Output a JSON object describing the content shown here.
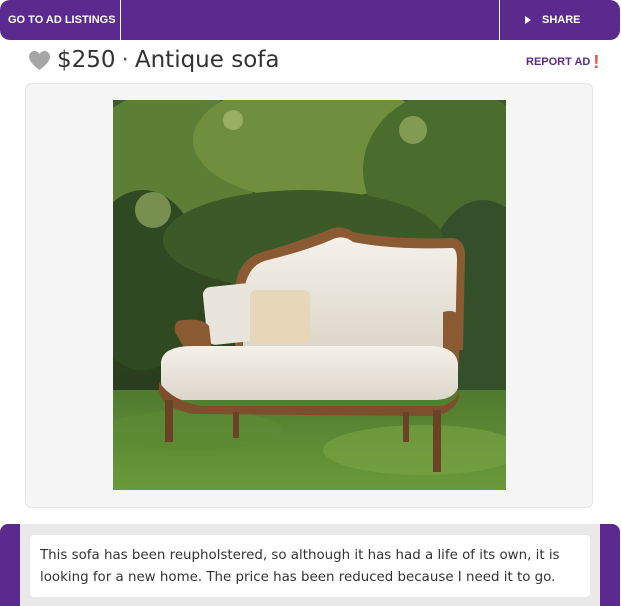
{
  "topbar": {
    "listings_label": "GO TO AD LISTINGS",
    "share_label": "SHARE"
  },
  "ad": {
    "price": "$250",
    "separator": "·",
    "title": "Antique sofa",
    "report_label": "REPORT AD",
    "report_mark": "!",
    "description": "This sofa has been reupholstered, so although it has had a life of its own, it is looking for a new home. The price has been reduced because I need it to go."
  },
  "colors": {
    "brand": "#5b2a8e",
    "alert": "#e74c3c",
    "favorite_icon": "#a6a6a6"
  },
  "icons": {
    "favorite": "heart-icon",
    "share": "play-triangle-icon",
    "report": "exclamation-icon"
  }
}
